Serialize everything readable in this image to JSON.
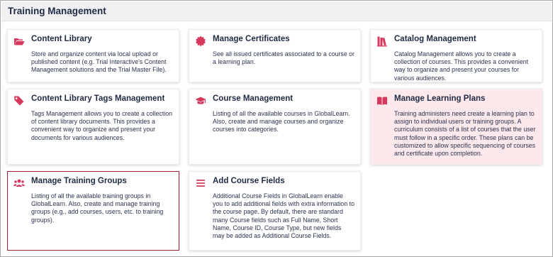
{
  "header": {
    "title": "Training Management"
  },
  "accent_color": "#d6395c",
  "cards": [
    {
      "key": "content-library",
      "icon": "folder-open-icon",
      "title": "Content Library",
      "desc": "Store and organize content via local upload or published content (e.g. Trial Interactive's Content Management solutions and the Trial Master File)."
    },
    {
      "key": "manage-certificates",
      "icon": "certificate-seal-icon",
      "title": "Manage Certificates",
      "desc": "See all issued certificates associated to a course or a learning plan."
    },
    {
      "key": "catalog-management",
      "icon": "books-icon",
      "title": "Catalog Management",
      "desc": "Catalog Management allows you to create a collection of courses. This provides a convenient way to organize and present your courses for various audiences."
    },
    {
      "key": "content-library-tags-management",
      "icon": "tags-icon",
      "title": "Content Library Tags Management",
      "desc": "Tags Management allows you to create a collection of content library documents. This provides a convenient way to organize and present your documents for various audiences."
    },
    {
      "key": "course-management",
      "icon": "graduation-cap-icon",
      "title": "Course Management",
      "desc": "Listing of all the available courses in GlobalLearn. Also, create and manage courses and organize courses into categories."
    },
    {
      "key": "manage-learning-plans",
      "icon": "open-book-icon",
      "title": "Manage Learning Plans",
      "desc": "Training administers need create a learning plan to assign to individual users or training groups. A curriculum consists of a list of courses that the user must follow in a specific order. These plans can be customized to allow specific sequencing of courses and certificate upon completion."
    },
    {
      "key": "manage-training-groups",
      "icon": "users-group-icon",
      "title": "Manage Training Groups",
      "desc": "Listing of all the available training groups in GlobalLearn. Also, create and manage training groups (e.g., add courses, users, etc. to training groups)."
    },
    {
      "key": "add-course-fields",
      "icon": "list-lines-icon",
      "title": "Add Course Fields",
      "desc": "Additional Course Fields in GlobalLearn enable you to add additional fields with extra information to the course page. By default, there are standard many Course fields such as Full Name, Short Name, Course ID, Course Type, but new fields may be added as Additional Course Fields."
    }
  ]
}
